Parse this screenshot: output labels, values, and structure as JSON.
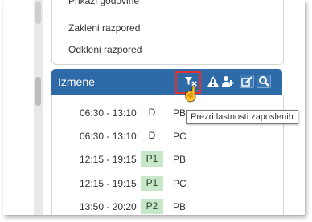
{
  "menu": {
    "items": [
      "Prikazi godovine",
      "Zakleni razpored",
      "Odkleni razpored"
    ]
  },
  "panel": {
    "title": "Izmene",
    "buttons": {
      "filter_icon": "filter-clear-icon",
      "warning_icon": "warning-icon",
      "people_icon": "people-icon",
      "edit_icon": "edit-icon",
      "search_icon": "search-icon"
    },
    "tooltip": "Prezri lastnosti zaposlenih"
  },
  "rows": [
    {
      "time": "06:30 - 13:10",
      "shift": "D",
      "loc": "PB"
    },
    {
      "time": "06:30 - 13:10",
      "shift": "D",
      "loc": "PC"
    },
    {
      "time": "12:15 - 19:15",
      "shift": "P1",
      "loc": "PB"
    },
    {
      "time": "12:15 - 19:15",
      "shift": "P1",
      "loc": "PC"
    },
    {
      "time": "13:50 - 20:20",
      "shift": "P2",
      "loc": "PB"
    }
  ],
  "colors": {
    "header": "#2f6aa8",
    "highlight": "#e3312f",
    "shift_green": "#c8e6c9"
  }
}
